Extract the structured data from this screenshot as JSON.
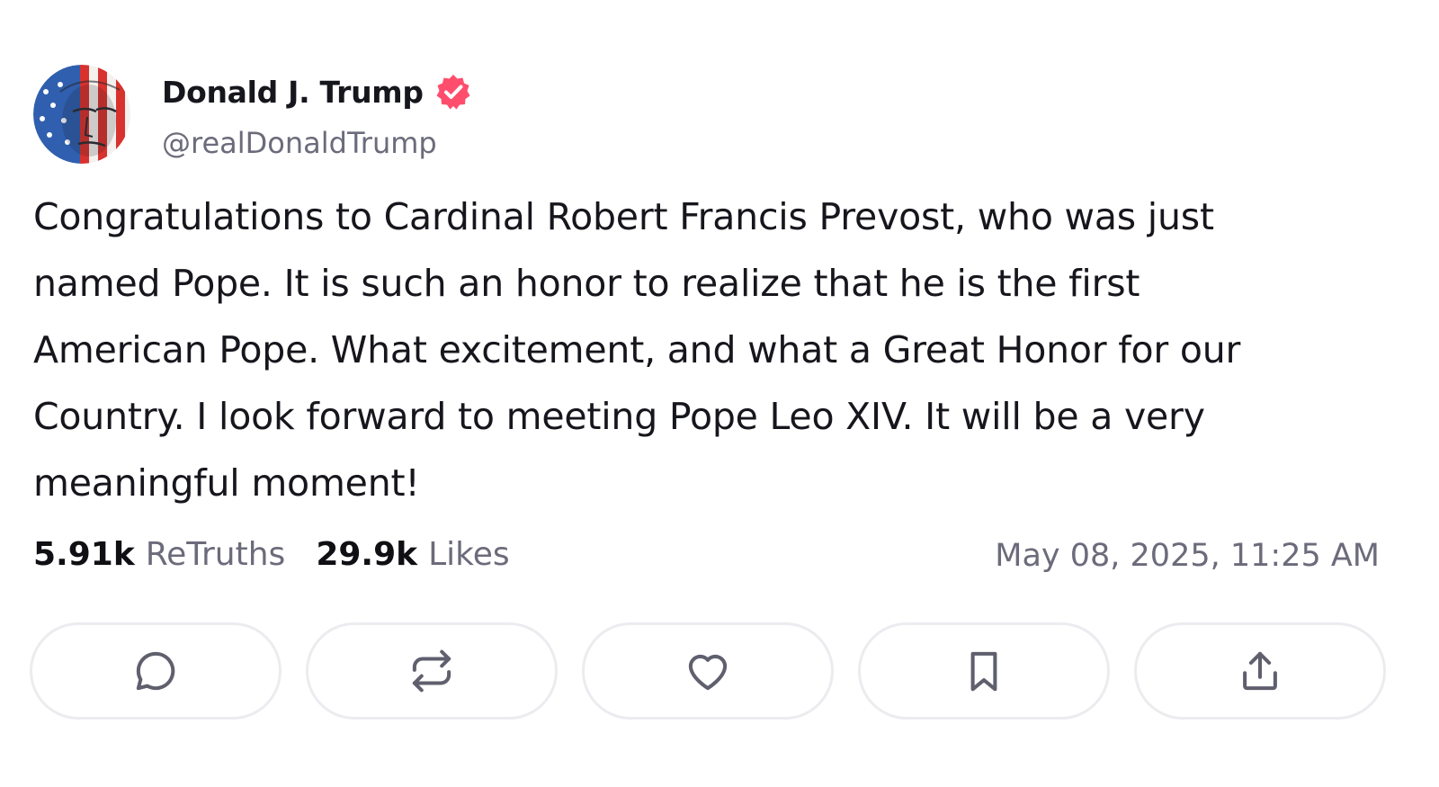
{
  "author": {
    "name": "Donald J. Trump",
    "handle": "@realDonaldTrump",
    "verified": true,
    "verified_color": "#ff4d6d",
    "avatar_icon": "flag-face-avatar"
  },
  "post": {
    "paragraphs": [
      "Congratulations to Cardinal Robert Francis Prevost, who was just named Pope. It is such an honor to realize that he is the first American Pope. What excitement, and what a Great Honor for our Country. I look forward to meeting Pope Leo XIV. It will be a very meaningful moment!"
    ],
    "lines": [
      "Congratulations to Cardinal Robert Francis Prevost, who was just",
      "named Pope. It is such an honor to realize that he is the first",
      "American Pope. What excitement, and what a Great Honor for our",
      "Country. I look forward to meeting Pope Leo XIV. It will be a very",
      "meaningful moment!"
    ]
  },
  "stats": {
    "retruths_count": "5.91k",
    "retruths_label": "ReTruths",
    "likes_count": "29.9k",
    "likes_label": "Likes"
  },
  "timestamp": "May 08, 2025, 11:25 AM",
  "actions": [
    {
      "name": "reply",
      "icon": "comment-icon"
    },
    {
      "name": "retruth",
      "icon": "repost-icon"
    },
    {
      "name": "like",
      "icon": "heart-icon"
    },
    {
      "name": "bookmark",
      "icon": "bookmark-icon"
    },
    {
      "name": "share",
      "icon": "share-icon"
    }
  ],
  "colors": {
    "text_primary": "#16161d",
    "text_secondary": "#6b6b7b",
    "icon_color": "#5f5f6e",
    "button_border": "#ececf0"
  }
}
